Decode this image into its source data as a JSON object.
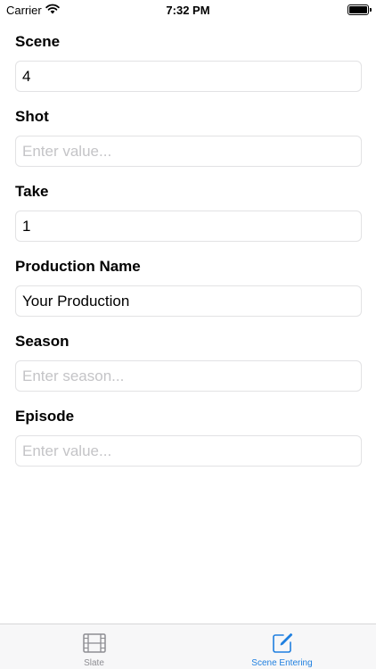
{
  "status_bar": {
    "carrier": "Carrier",
    "time": "7:32 PM",
    "battery_level": 1.0
  },
  "form": {
    "fields": [
      {
        "label": "Scene",
        "value": "4",
        "placeholder": ""
      },
      {
        "label": "Shot",
        "value": "",
        "placeholder": "Enter value..."
      },
      {
        "label": "Take",
        "value": "1",
        "placeholder": ""
      },
      {
        "label": "Production Name",
        "value": "Your Production",
        "placeholder": ""
      },
      {
        "label": "Season",
        "value": "",
        "placeholder": "Enter season..."
      },
      {
        "label": "Episode",
        "value": "",
        "placeholder": "Enter value..."
      }
    ]
  },
  "tab_bar": {
    "tabs": [
      {
        "label": "Slate",
        "icon": "film-icon",
        "active": false
      },
      {
        "label": "Scene Entering",
        "icon": "edit-icon",
        "active": true
      }
    ],
    "active_color": "#1e7fe0",
    "inactive_color": "#8e8e93"
  }
}
